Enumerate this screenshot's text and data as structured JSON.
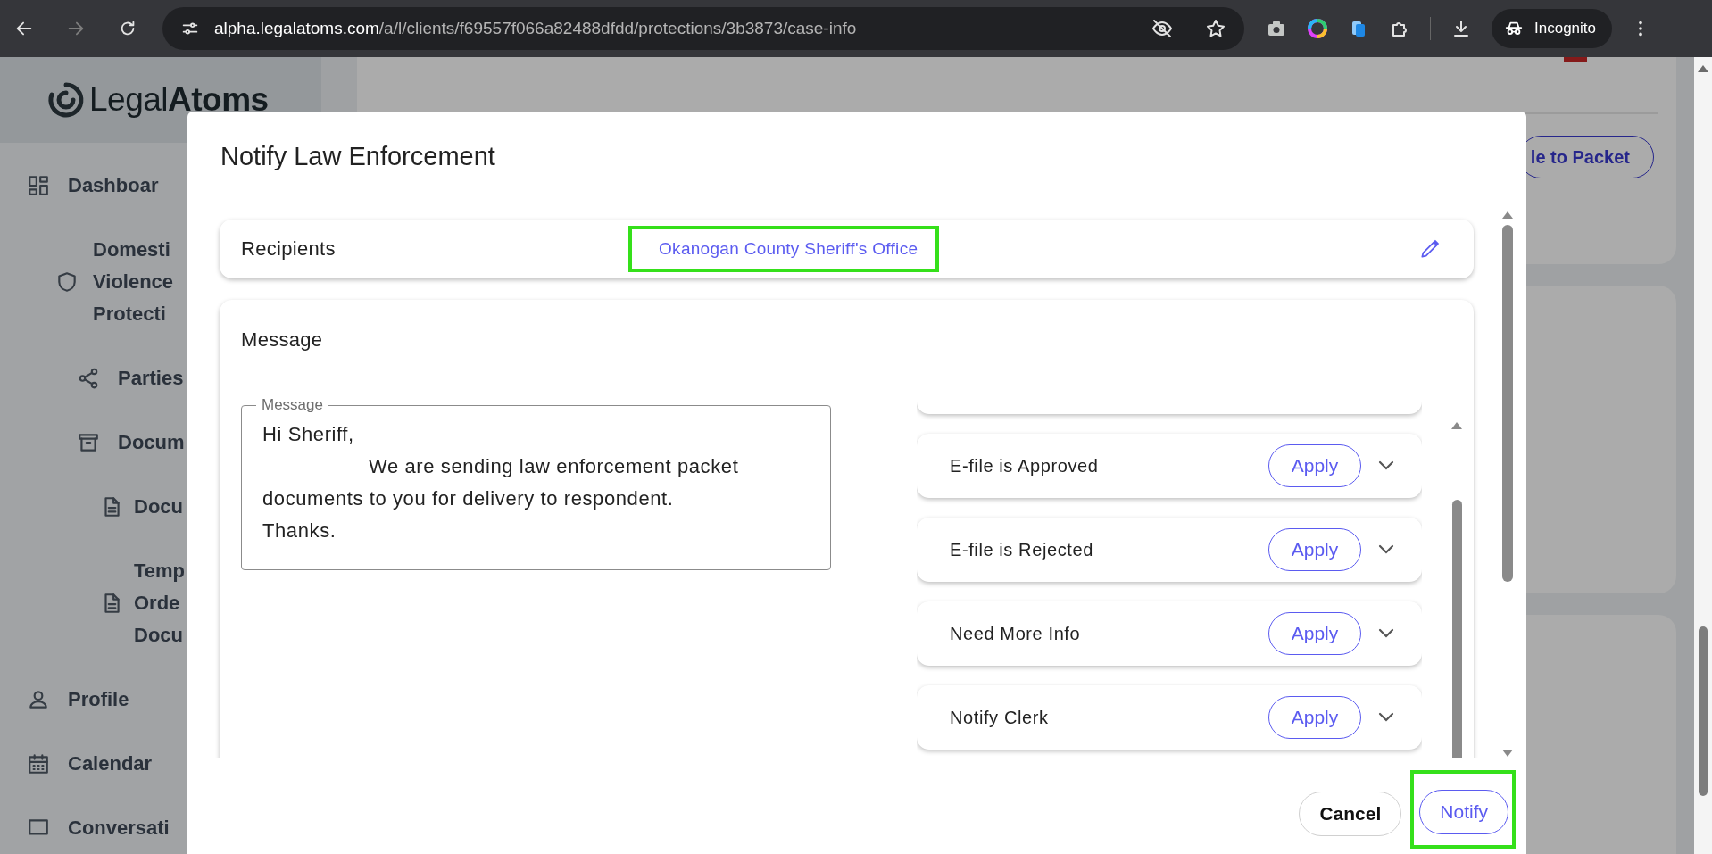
{
  "browser": {
    "url_host": "alpha.legalatoms.com",
    "url_path": "/a/l/clients/f69557f066a82488dfdd/protections/3b3873/case-info",
    "profile": "Incognito"
  },
  "sidebar": {
    "logo": "Legal**Atoms**",
    "items": [
      {
        "kind": "dashboard",
        "lines": [
          "Dashboar"
        ]
      },
      {
        "kind": "case",
        "lines": [
          "Domesti",
          "Violence",
          "Protecti"
        ],
        "children": [
          {
            "kind": "parties",
            "lines": [
              "Parties"
            ]
          },
          {
            "kind": "folder",
            "lines": [
              "Docum"
            ],
            "children": [
              {
                "kind": "document",
                "lines": [
                  "Docu"
                ]
              },
              {
                "kind": "document",
                "lines": [
                  "Temp",
                  "Orde",
                  "Docu"
                ]
              }
            ]
          }
        ]
      },
      {
        "kind": "profile",
        "lines": [
          "Profile"
        ]
      },
      {
        "kind": "calendar",
        "lines": [
          "Calendar"
        ]
      },
      {
        "kind": "chat",
        "lines": [
          "Conversati"
        ]
      }
    ]
  },
  "page_button": "le to Packet",
  "dialog": {
    "title": "Notify Law Enforcement",
    "recipients": {
      "label": "Recipients",
      "value": "Okanogan County Sheriff's Office",
      "highlighted": true
    },
    "message": {
      "heading": "Message",
      "field_label": "Message",
      "value": "Hi Sheriff,\n\tWe are sending law enforcement packet documents to you for delivery to respondent.\nThanks."
    },
    "templates": [
      {
        "label": "E-file is Approved",
        "action": "Apply"
      },
      {
        "label": "E-file is Rejected",
        "action": "Apply"
      },
      {
        "label": "Need More Info",
        "action": "Apply"
      },
      {
        "label": "Notify Clerk",
        "action": "Apply"
      }
    ],
    "buttons": [
      {
        "label": "Cancel",
        "kind": "secondary",
        "highlighted": false
      },
      {
        "label": "Notify",
        "kind": "primary",
        "highlighted": true
      }
    ]
  }
}
